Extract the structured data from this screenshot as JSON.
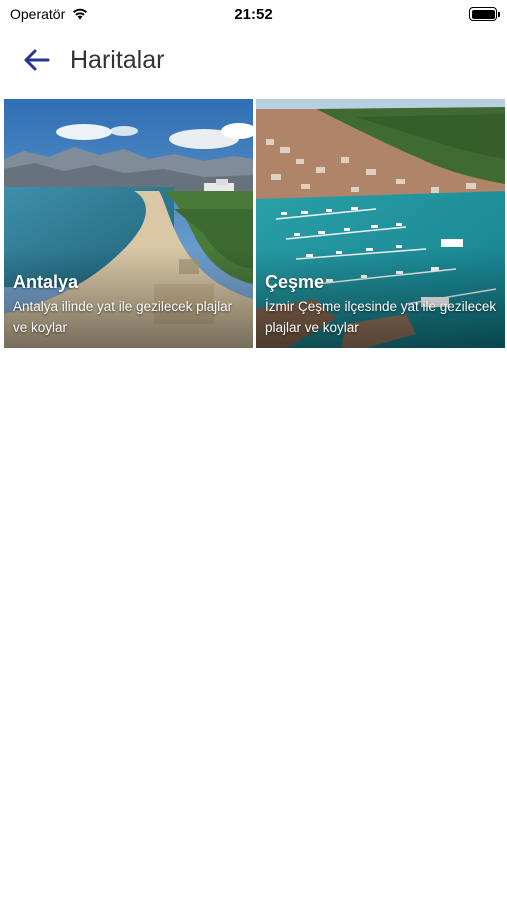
{
  "status_bar": {
    "carrier": "Operatör",
    "time": "21:52",
    "icons": [
      "wifi-icon",
      "battery-icon"
    ]
  },
  "header": {
    "back_icon": "arrow-left-icon",
    "title": "Haritalar",
    "accent_color": "#283593"
  },
  "maps": [
    {
      "title": "Antalya",
      "description": "Antalya ilinde yat ile gezilecek plajlar ve koylar"
    },
    {
      "title": "Çeşme",
      "description": "İzmir Çeşme ilçesinde yat ile gezilecek plajlar ve koylar"
    }
  ]
}
